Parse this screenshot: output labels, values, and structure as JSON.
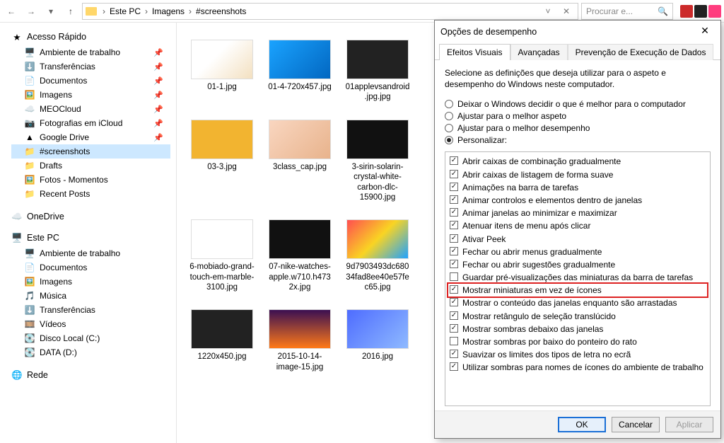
{
  "toolbar": {
    "breadcrumb": [
      "Este PC",
      "Imagens",
      "#screenshots"
    ],
    "search_placeholder": "Procurar e...",
    "refresh_icon": "↻",
    "close_icon": "✕"
  },
  "tray_colors": [
    "#cc2a2a",
    "#222222",
    "#ff3d7f"
  ],
  "sidebar": {
    "quick": {
      "label": "Acesso Rápido",
      "items": [
        {
          "icon": "🖥️",
          "label": "Ambiente de trabalho",
          "pin": true
        },
        {
          "icon": "⬇️",
          "label": "Transferências",
          "pin": true
        },
        {
          "icon": "📄",
          "label": "Documentos",
          "pin": true
        },
        {
          "icon": "🖼️",
          "label": "Imagens",
          "pin": true
        },
        {
          "icon": "☁️",
          "label": "MEOCloud",
          "pin": true
        },
        {
          "icon": "📷",
          "label": "Fotografias em iCloud",
          "pin": true
        },
        {
          "icon": "▲",
          "label": "Google Drive",
          "pin": true
        },
        {
          "icon": "📁",
          "label": "#screenshots",
          "pin": false,
          "selected": true
        },
        {
          "icon": "📁",
          "label": "Drafts",
          "pin": false
        },
        {
          "icon": "🖼️",
          "label": "Fotos - Momentos",
          "pin": false
        },
        {
          "icon": "📁",
          "label": "Recent Posts",
          "pin": false
        }
      ]
    },
    "onedrive": {
      "icon": "☁️",
      "label": "OneDrive"
    },
    "thispc": {
      "icon": "🖥️",
      "label": "Este PC",
      "items": [
        {
          "icon": "🖥️",
          "label": "Ambiente de trabalho"
        },
        {
          "icon": "📄",
          "label": "Documentos"
        },
        {
          "icon": "🖼️",
          "label": "Imagens"
        },
        {
          "icon": "🎵",
          "label": "Música"
        },
        {
          "icon": "⬇️",
          "label": "Transferências"
        },
        {
          "icon": "🎞️",
          "label": "Vídeos"
        },
        {
          "icon": "💽",
          "label": "Disco Local (C:)"
        },
        {
          "icon": "💽",
          "label": "DATA (D:)"
        }
      ]
    },
    "network": {
      "icon": "🌐",
      "label": "Rede"
    }
  },
  "files": [
    {
      "name": "01-1.jpg",
      "cls": "tc-a"
    },
    {
      "name": "01-4-720x457.jpg",
      "cls": "tc-b"
    },
    {
      "name": "01applevsandroid.jpg.jpg",
      "cls": "tc-c"
    },
    {
      "name": "",
      "cls": ""
    },
    {
      "name": "03-3.jpg",
      "cls": "tc-d"
    },
    {
      "name": "3class_cap.jpg",
      "cls": "tc-e"
    },
    {
      "name": "3-sirin-solarin-crystal-white-carbon-dlc-15900.jpg",
      "cls": "tc-f"
    },
    {
      "name": "",
      "cls": ""
    },
    {
      "name": "6-mobiado-grand-touch-em-marble-3100.jpg",
      "cls": "tc-g"
    },
    {
      "name": "07-nike-watches-apple.w710.h4732x.jpg",
      "cls": "tc-h"
    },
    {
      "name": "9d7903493dc68034fad8ee40e57fec65.jpg",
      "cls": "tc-i"
    },
    {
      "name": "",
      "cls": ""
    },
    {
      "name": "1220x450.jpg",
      "cls": "tc-j"
    },
    {
      "name": "2015-10-14-image-15.jpg",
      "cls": "tc-k"
    },
    {
      "name": "2016.jpg",
      "cls": "tc-l"
    }
  ],
  "dialog": {
    "title": "Opções de desempenho",
    "tabs": [
      "Efeitos Visuais",
      "Avançadas",
      "Prevenção de Execução de Dados"
    ],
    "active_tab": 0,
    "description": "Selecione as definições que deseja utilizar para o aspeto e desempenho do Windows neste computador.",
    "radios": [
      {
        "label": "Deixar o Windows decidir o que é melhor para o computador",
        "selected": false
      },
      {
        "label": "Ajustar para o melhor aspeto",
        "selected": false
      },
      {
        "label": "Ajustar para o melhor desempenho",
        "selected": false
      },
      {
        "label": "Personalizar:",
        "selected": true
      }
    ],
    "options": [
      {
        "label": "Abrir caixas de combinação gradualmente",
        "checked": true
      },
      {
        "label": "Abrir caixas de listagem de forma suave",
        "checked": true
      },
      {
        "label": "Animações na barra de tarefas",
        "checked": true
      },
      {
        "label": "Animar controlos e elementos dentro de janelas",
        "checked": true
      },
      {
        "label": "Animar janelas ao minimizar e maximizar",
        "checked": true
      },
      {
        "label": "Atenuar itens de menu após clicar",
        "checked": true
      },
      {
        "label": "Ativar Peek",
        "checked": true
      },
      {
        "label": "Fechar ou abrir menus gradualmente",
        "checked": true
      },
      {
        "label": "Fechar ou abrir sugestões gradualmente",
        "checked": true
      },
      {
        "label": "Guardar pré-visualizações das miniaturas da barra de tarefas",
        "checked": false
      },
      {
        "label": "Mostrar miniaturas em vez de ícones",
        "checked": true,
        "highlight": true
      },
      {
        "label": "Mostrar o conteúdo das janelas enquanto são arrastadas",
        "checked": true
      },
      {
        "label": "Mostrar retângulo de seleção translúcido",
        "checked": true
      },
      {
        "label": "Mostrar sombras debaixo das janelas",
        "checked": true
      },
      {
        "label": "Mostrar sombras por baixo do ponteiro do rato",
        "checked": false
      },
      {
        "label": "Suavizar os limites dos tipos de letra no ecrã",
        "checked": true
      },
      {
        "label": "Utilizar sombras para nomes de ícones do ambiente de trabalho",
        "checked": true
      }
    ],
    "buttons": {
      "ok": "OK",
      "cancel": "Cancelar",
      "apply": "Aplicar"
    }
  }
}
